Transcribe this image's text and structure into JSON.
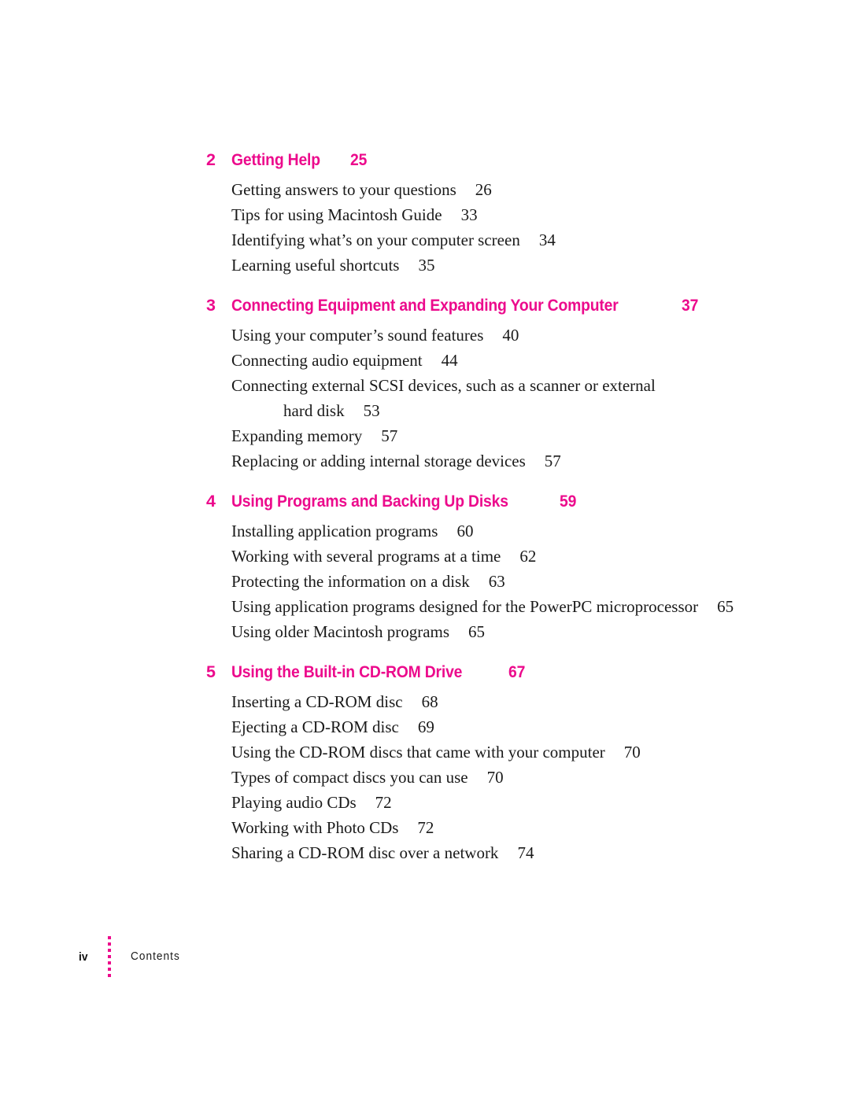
{
  "document": {
    "kind": "table-of-contents",
    "accent_color": "#ec0a8c",
    "text_color": "#1a1a1a"
  },
  "toc": {
    "chapters": [
      {
        "number": "2",
        "title": "Getting Help",
        "page": "25",
        "entries": [
          {
            "text": "Getting answers to your questions",
            "page": "26"
          },
          {
            "text": "Tips for using Macintosh Guide",
            "page": "33"
          },
          {
            "text": "Identifying what’s on your computer screen",
            "page": "34"
          },
          {
            "text": "Learning useful shortcuts",
            "page": "35"
          }
        ]
      },
      {
        "number": "3",
        "title": "Connecting Equipment and Expanding Your Computer",
        "page": "37",
        "entries": [
          {
            "text": "Using your computer’s sound features",
            "page": "40"
          },
          {
            "text": "Connecting audio equipment",
            "page": "44"
          },
          {
            "text": "Connecting external SCSI devices, such as a scanner or external",
            "continuation": "hard disk",
            "page": "53"
          },
          {
            "text": "Expanding memory",
            "page": "57"
          },
          {
            "text": "Replacing or adding internal storage devices",
            "page": "57"
          }
        ]
      },
      {
        "number": "4",
        "title": "Using Programs and Backing Up Disks",
        "page": "59",
        "entries": [
          {
            "text": "Installing application programs",
            "page": "60"
          },
          {
            "text": "Working with several programs at a time",
            "page": "62"
          },
          {
            "text": "Protecting the information on a disk",
            "page": "63"
          },
          {
            "text": "Using application programs designed for the PowerPC microprocessor",
            "page": "65"
          },
          {
            "text": "Using older Macintosh programs",
            "page": "65"
          }
        ]
      },
      {
        "number": "5",
        "title": "Using the Built-in CD-ROM Drive",
        "page": "67",
        "entries": [
          {
            "text": "Inserting a CD-ROM disc",
            "page": "68"
          },
          {
            "text": "Ejecting a CD-ROM disc",
            "page": "69"
          },
          {
            "text": "Using the CD-ROM discs that came with your computer",
            "page": "70"
          },
          {
            "text": "Types of compact discs you can use",
            "page": "70"
          },
          {
            "text": "Playing audio CDs",
            "page": "72"
          },
          {
            "text": "Working with Photo CDs",
            "page": "72"
          },
          {
            "text": "Sharing a CD-ROM disc over a network",
            "page": "74"
          }
        ]
      }
    ]
  },
  "footer": {
    "folio": "iv",
    "label": "Contents",
    "dot_count": 7,
    "dot_color": "#ec0a8c"
  }
}
